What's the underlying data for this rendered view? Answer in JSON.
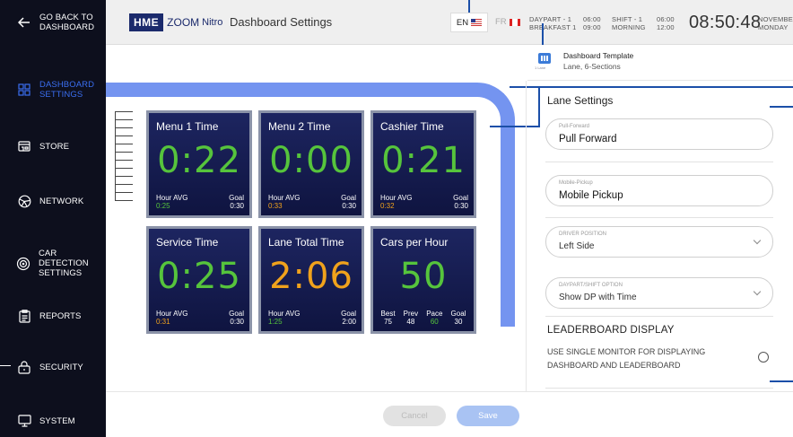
{
  "sidebar": {
    "back_label": "GO BACK TO\nDASHBOARD",
    "items": [
      {
        "label": "DASHBOARD\nSETTINGS",
        "icon": "dashboard-icon",
        "active": true
      },
      {
        "label": "STORE",
        "icon": "store-icon"
      },
      {
        "label": "NETWORK",
        "icon": "network-icon"
      },
      {
        "label": "CAR DETECTION\nSETTINGS",
        "icon": "car-detection-icon"
      },
      {
        "label": "REPORTS",
        "icon": "reports-icon"
      },
      {
        "label": "SECURITY",
        "icon": "lock-icon"
      },
      {
        "label": "SYSTEM",
        "icon": "monitor-icon"
      }
    ]
  },
  "header": {
    "logo_hme": "HME",
    "logo_product": "ZOOM",
    "logo_product2": "Nitro",
    "title": "Dashboard Settings",
    "lang_en": "EN",
    "lang_fr": "FR",
    "daypart": "DAYPART - 1\nBREAKFAST 1",
    "daypart_time": "06:00\n09:00",
    "shift": "SHIFT - 1\nMORNING",
    "shift_time": "06:00\n12:00",
    "clock": "08:50:48",
    "date": "NOVEMBER\nMONDAY"
  },
  "template": {
    "icon_caption": "1 Lane",
    "title": "Dashboard Template",
    "desc": "Lane, 6-Sections"
  },
  "tiles": [
    {
      "title": "Menu 1 Time",
      "value": "0:22",
      "color": "#56c43c",
      "left_label": "Hour AVG",
      "left_value": "0:25",
      "left_color": "#56c43c",
      "right_label": "Goal",
      "right_value": "0:30"
    },
    {
      "title": "Menu 2 Time",
      "value": "0:00",
      "color": "#56c43c",
      "left_label": "Hour AVG",
      "left_value": "0:33",
      "left_color": "#f0a21c",
      "right_label": "Goal",
      "right_value": "0:30"
    },
    {
      "title": "Cashier Time",
      "value": "0:21",
      "color": "#56c43c",
      "left_label": "Hour AVG",
      "left_value": "0:32",
      "left_color": "#f0a21c",
      "right_label": "Goal",
      "right_value": "0:30"
    },
    {
      "title": "Service Time",
      "value": "0:25",
      "color": "#56c43c",
      "left_label": "Hour AVG",
      "left_value": "0:31",
      "left_color": "#f0a21c",
      "right_label": "Goal",
      "right_value": "0:30"
    },
    {
      "title": "Lane Total Time",
      "value": "2:06",
      "color": "#f0a21c",
      "left_label": "Hour AVG",
      "left_value": "1:25",
      "left_color": "#56c43c",
      "right_label": "Goal",
      "right_value": "2:00"
    }
  ],
  "cars_tile": {
    "title": "Cars per Hour",
    "value": "50",
    "color": "#56c43c",
    "stats": [
      {
        "label": "Best",
        "value": "75",
        "color": "#ffffff"
      },
      {
        "label": "Prev",
        "value": "48",
        "color": "#ffffff"
      },
      {
        "label": "Pace",
        "value": "60",
        "color": "#56c43c"
      },
      {
        "label": "Goal",
        "value": "30",
        "color": "#ffffff"
      }
    ]
  },
  "lane_settings": {
    "title": "Lane Settings",
    "pull_forward_label": "Pull-Forward",
    "pull_forward_value": "Pull Forward",
    "mobile_pickup_label": "Mobile-Pickup",
    "mobile_pickup_value": "Mobile Pickup",
    "driver_position_label": "DRIVER POSITION",
    "driver_position_value": "Left Side",
    "daypart_option_label": "DAYPART/SHIFT OPTION",
    "daypart_option_value": "Show DP with Time",
    "leaderboard_title": "LEADERBOARD DISPLAY",
    "leaderboard_desc": "USE SINGLE MONITOR FOR DISPLAYING DASHBOARD AND LEADERBOARD"
  },
  "buttons": {
    "cancel": "Cancel",
    "save": "Save"
  },
  "colors": {
    "accent": "#1b4fa8",
    "frame": "#7494f0",
    "sidebar": "#0d0f1d",
    "active_nav": "#3a6ef0"
  }
}
